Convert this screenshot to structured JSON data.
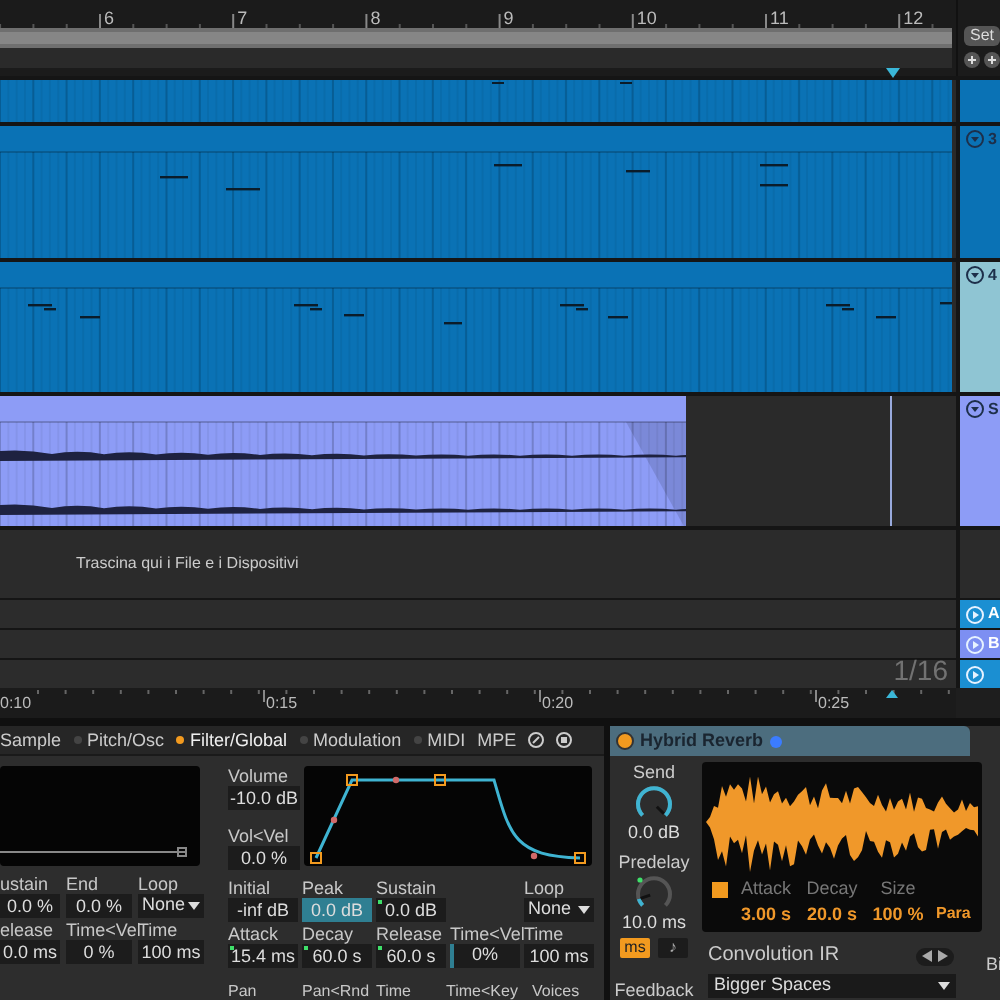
{
  "ruler": {
    "bars": [
      "6",
      "7",
      "8",
      "9",
      "10",
      "11",
      "12"
    ]
  },
  "set_button": "Set",
  "tracks": [
    {
      "kind": "midi",
      "color": "#0a72b5",
      "selected": false
    },
    {
      "kind": "midi",
      "number": "3",
      "color": "#0a72b5",
      "selected": false
    },
    {
      "kind": "midi",
      "number": "4",
      "color": "#0a72b5",
      "selected": true
    },
    {
      "kind": "audio",
      "number": "S",
      "color": "#8d9cf6",
      "selected": false
    }
  ],
  "drop_hint": "Trascina qui i File e i Dispositivi",
  "returns": [
    {
      "label": "A",
      "color": "#1b8fd2"
    },
    {
      "label": "B",
      "color": "#7d8ff2"
    },
    {
      "color": "#1b8fd2"
    }
  ],
  "grid_label": "1/16",
  "time_ruler": [
    "0:10",
    "0:15",
    "0:20",
    "0:25"
  ],
  "simpler": {
    "tabs": [
      {
        "label": "Sample",
        "kind": "plain",
        "on": false
      },
      {
        "label": "Pitch/Osc",
        "kind": "toggle",
        "on": false
      },
      {
        "label": "Filter/Global",
        "kind": "toggle",
        "on": true
      },
      {
        "label": "Modulation",
        "kind": "toggle",
        "on": false
      },
      {
        "label": "MIDI",
        "kind": "toggle",
        "on": false
      },
      {
        "label": "MPE",
        "kind": "plain",
        "on": false
      }
    ],
    "left_params": [
      {
        "label": "ustain",
        "value": "0.0 %"
      },
      {
        "label": "End",
        "value": "0.0 %"
      },
      {
        "label": "Loop",
        "value": "None",
        "kind": "dropdown"
      },
      {
        "label": "elease",
        "value": "0.0 ms"
      },
      {
        "label": "Time<Vel",
        "value": "0 %"
      },
      {
        "label": "Time",
        "value": "100 ms"
      }
    ],
    "volume": {
      "label": "Volume",
      "value": "-10.0 dB"
    },
    "vol_vel": {
      "label": "Vol<Vel",
      "value": "0.0 %"
    },
    "env_params": [
      {
        "label": "Initial",
        "value": "-inf dB"
      },
      {
        "label": "Peak",
        "value": "0.0 dB",
        "selected": true
      },
      {
        "label": "Sustain",
        "value": "0.0 dB",
        "selected": false
      },
      {
        "kind": "empty"
      },
      {
        "label": "Loop",
        "value": "None",
        "kind": "dropdown"
      },
      {
        "label": "Attack",
        "value": "15.4 ms",
        "selected": false
      },
      {
        "label": "Decay",
        "value": "60.0 s",
        "selected": false
      },
      {
        "label": "Release",
        "value": "60.0 s",
        "selected": false
      },
      {
        "label": "Time<Vel",
        "value": "0%",
        "kind": "slider",
        "level": 0.05
      },
      {
        "label": "Time",
        "value": "100 ms"
      }
    ],
    "bottom_labels": [
      "Pan",
      "Pan<Rnd",
      "Time",
      "Time<Key",
      "Voices"
    ]
  },
  "reverb": {
    "title": "Hybrid Reverb",
    "on": true,
    "send": {
      "label": "Send",
      "value": "0.0 dB",
      "level": 1
    },
    "predelay": {
      "label": "Predelay",
      "value": "10.0 ms",
      "level": 0.1
    },
    "sync_buttons": [
      {
        "label": "ms",
        "selected": true
      },
      {
        "label": "♪",
        "selected": false
      }
    ],
    "feedback_label": "Feedback",
    "display_params": [
      {
        "label": "Attack",
        "value": "3.00 s"
      },
      {
        "label": "Decay",
        "value": "20.0 s"
      },
      {
        "label": "Size",
        "value": "100 %"
      }
    ],
    "attack_toggle": true,
    "para_label": "Para",
    "convolution_label": "Convolution IR",
    "ir_category": "Bigger Spaces",
    "side_label": "Bi"
  }
}
